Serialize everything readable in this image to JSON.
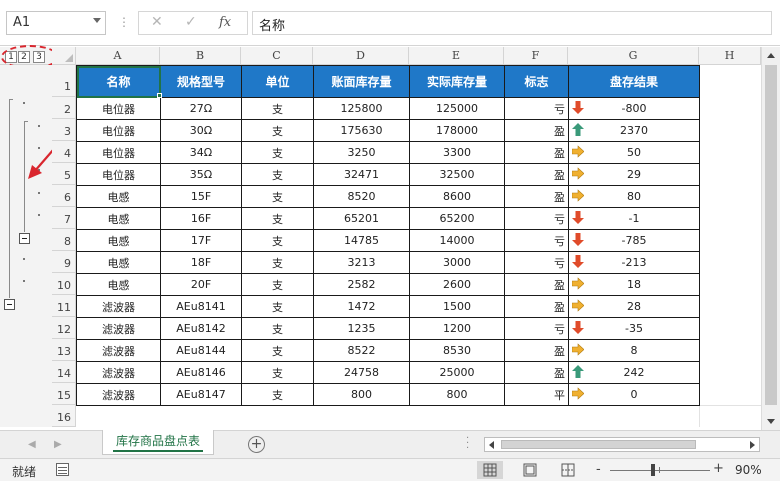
{
  "formula_bar": {
    "name_box": "A1",
    "cancel_icon": "✕",
    "enter_icon": "✓",
    "fx_label": "fx",
    "content": "名称"
  },
  "outline": {
    "levels": [
      "1",
      "2",
      "3"
    ]
  },
  "columns": [
    "A",
    "B",
    "C",
    "D",
    "E",
    "F",
    "G",
    "H"
  ],
  "rows": [
    "1",
    "2",
    "3",
    "4",
    "5",
    "6",
    "7",
    "8",
    "9",
    "10",
    "11",
    "12",
    "13",
    "14",
    "15",
    "16"
  ],
  "table": {
    "headers": [
      "名称",
      "规格型号",
      "单位",
      "账面库存量",
      "实际库存量",
      "标志",
      "盘存结果"
    ],
    "rows": [
      {
        "name": "电位器",
        "model": "27Ω",
        "unit": "支",
        "book": "125800",
        "actual": "125000",
        "flag": "亏",
        "result": "-800",
        "icon": "down"
      },
      {
        "name": "电位器",
        "model": "30Ω",
        "unit": "支",
        "book": "175630",
        "actual": "178000",
        "flag": "盈",
        "result": "2370",
        "icon": "up"
      },
      {
        "name": "电位器",
        "model": "34Ω",
        "unit": "支",
        "book": "3250",
        "actual": "3300",
        "flag": "盈",
        "result": "50",
        "icon": "right"
      },
      {
        "name": "电位器",
        "model": "35Ω",
        "unit": "支",
        "book": "32471",
        "actual": "32500",
        "flag": "盈",
        "result": "29",
        "icon": "right"
      },
      {
        "name": "电感",
        "model": "15F",
        "unit": "支",
        "book": "8520",
        "actual": "8600",
        "flag": "盈",
        "result": "80",
        "icon": "right"
      },
      {
        "name": "电感",
        "model": "16F",
        "unit": "支",
        "book": "65201",
        "actual": "65200",
        "flag": "亏",
        "result": "-1",
        "icon": "down"
      },
      {
        "name": "电感",
        "model": "17F",
        "unit": "支",
        "book": "14785",
        "actual": "14000",
        "flag": "亏",
        "result": "-785",
        "icon": "down"
      },
      {
        "name": "电感",
        "model": "18F",
        "unit": "支",
        "book": "3213",
        "actual": "3000",
        "flag": "亏",
        "result": "-213",
        "icon": "down"
      },
      {
        "name": "电感",
        "model": "20F",
        "unit": "支",
        "book": "2582",
        "actual": "2600",
        "flag": "盈",
        "result": "18",
        "icon": "right"
      },
      {
        "name": "滤波器",
        "model": "AEu8141",
        "unit": "支",
        "book": "1472",
        "actual": "1500",
        "flag": "盈",
        "result": "28",
        "icon": "right"
      },
      {
        "name": "滤波器",
        "model": "AEu8142",
        "unit": "支",
        "book": "1235",
        "actual": "1200",
        "flag": "亏",
        "result": "-35",
        "icon": "down"
      },
      {
        "name": "滤波器",
        "model": "AEu8144",
        "unit": "支",
        "book": "8522",
        "actual": "8530",
        "flag": "盈",
        "result": "8",
        "icon": "right"
      },
      {
        "name": "滤波器",
        "model": "AEu8146",
        "unit": "支",
        "book": "24758",
        "actual": "25000",
        "flag": "盈",
        "result": "242",
        "icon": "up"
      },
      {
        "name": "滤波器",
        "model": "AEu8147",
        "unit": "支",
        "book": "800",
        "actual": "800",
        "flag": "平",
        "result": "0",
        "icon": "right"
      }
    ]
  },
  "colors": {
    "header_fill": "#1f78c8",
    "up_icon": "#3a9a7a",
    "down_icon": "#e04b2a",
    "right_icon": "#f0b030",
    "annotation": "#d9262e",
    "excel_green": "#217346"
  },
  "sheet_tabs": [
    {
      "label": "库存商品盘点表",
      "active": true
    }
  ],
  "status_bar": {
    "status": "就绪",
    "zoom": "90%",
    "zoom_minus": "-",
    "zoom_plus": "+"
  }
}
